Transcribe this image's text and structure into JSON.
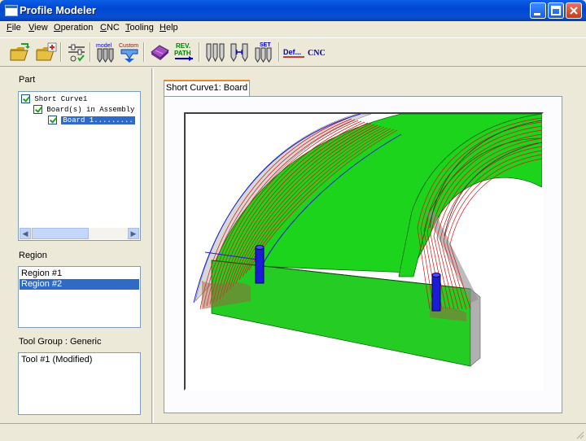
{
  "window": {
    "title": "Profile Modeler"
  },
  "menu": [
    {
      "label": "File",
      "key": "F",
      "rest": "ile"
    },
    {
      "label": "View",
      "key": "V",
      "rest": "iew"
    },
    {
      "label": "Operation",
      "key": "O",
      "rest": "peration"
    },
    {
      "label": "CNC",
      "key": "C",
      "rest": "NC"
    },
    {
      "label": "Tooling",
      "key": "T",
      "rest": "ooling"
    },
    {
      "label": "Help",
      "key": "H",
      "rest": "elp"
    }
  ],
  "toolbar": {
    "model_label": "model",
    "custom_label": "Custom",
    "rev_path_label_1": "REV.",
    "rev_path_label_2": "PATH",
    "set_label": "SET",
    "def_label": "Def...",
    "cnc_label": "CNC"
  },
  "part": {
    "heading": "Part",
    "tree": [
      {
        "label": "Short Curve1"
      },
      {
        "label": "Board(s) in Assembly"
      },
      {
        "label": "Board 1........."
      }
    ]
  },
  "region": {
    "heading": "Region",
    "items": [
      {
        "label": "Region #1",
        "selected": false
      },
      {
        "label": "Region #2",
        "selected": true
      }
    ]
  },
  "tool_group": {
    "heading": "Tool Group : Generic",
    "items": [
      {
        "label": "Tool #1 (Modified)"
      }
    ]
  },
  "view": {
    "tab_label": "Short Curve1: Board"
  },
  "colors": {
    "board": "#1cd41c",
    "toolpath": "#e01010",
    "tool": "#1c1cd8",
    "selection": "#316ac5",
    "title": "#0046d5"
  }
}
